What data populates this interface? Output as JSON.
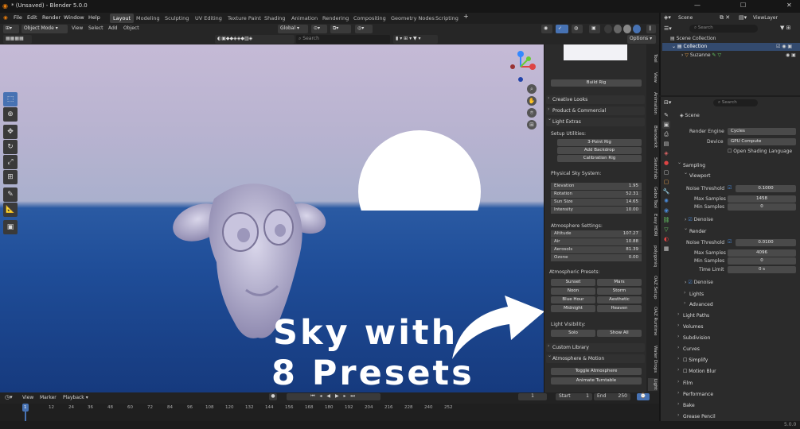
{
  "titlebar": {
    "title": "* (Unsaved) - Blender 5.0.0"
  },
  "menus": [
    "File",
    "Edit",
    "Render",
    "Window",
    "Help"
  ],
  "workspaces": [
    "Layout",
    "Modeling",
    "Sculpting",
    "UV Editing",
    "Texture Paint",
    "Shading",
    "Animation",
    "Rendering",
    "Compositing",
    "Geometry Nodes",
    "Scripting"
  ],
  "topright": {
    "scene": "Scene",
    "viewlayer": "ViewLayer"
  },
  "header": {
    "mode": "Object Mode",
    "menus": [
      "View",
      "Select",
      "Add",
      "Object"
    ],
    "orientation": "Global",
    "options": "Options",
    "search_placeholder": "Search"
  },
  "overlay": {
    "line1": "Sky with",
    "line2": "8 Presets"
  },
  "npanel": {
    "build_rig": "Build Rig",
    "sections": {
      "creative": "Creative Looks",
      "product": "Product & Commercial",
      "light_extras": "Light Extras",
      "custom": "Custom Library",
      "atmo_motion": "Atmosphere & Motion"
    },
    "setup_label": "Setup Utilities:",
    "setup_buttons": [
      "3-Point Rig",
      "Add Backdrop",
      "Calibration Rig"
    ],
    "sky_label": "Physical Sky System:",
    "sky_fields": [
      {
        "label": "Elevation",
        "value": "1.95"
      },
      {
        "label": "Rotation",
        "value": "52.31"
      },
      {
        "label": "Sun Size",
        "value": "14.65"
      },
      {
        "label": "Intensity",
        "value": "10.00"
      }
    ],
    "atmo_label": "Atmosphere Settings:",
    "atmo_fields": [
      {
        "label": "Altitude",
        "value": "107.27"
      },
      {
        "label": "Air",
        "value": "10.88"
      },
      {
        "label": "Aerosols",
        "value": "81.39"
      },
      {
        "label": "Ozone",
        "value": "0.00"
      }
    ],
    "presets_label": "Atmospheric Presets:",
    "presets": [
      "Sunset",
      "Mars",
      "Noon",
      "Storm",
      "Blue Hour",
      "Aesthetic",
      "Midnight",
      "Heaven"
    ],
    "visibility_label": "Light Visibility:",
    "visibility_buttons": [
      "Solo",
      "Show All"
    ],
    "toggle_atmo": "Toggle Atmosphere",
    "animate_turntable": "Animate Turntable"
  },
  "vtabs": [
    "Tool",
    "View",
    "Animation",
    "Blenderkit",
    "Sketchfab",
    "Gobo Tool",
    "Easy HDRI",
    "polygoniq",
    "OAZ Setup",
    "OAZ Runtime",
    "Water Drops",
    "Light"
  ],
  "outliner": {
    "search_placeholder": "Search",
    "collection_root": "Scene Collection",
    "collection": "Collection",
    "object": "Suzanne"
  },
  "properties": {
    "search_placeholder": "Search",
    "scene": "Scene",
    "render_engine_label": "Render Engine",
    "render_engine": "Cycles",
    "device_label": "Device",
    "device": "GPU Compute",
    "osl_label": "Open Shading Language",
    "sampling": "Sampling",
    "viewport": "Viewport",
    "noise_threshold_label": "Noise Threshold",
    "viewport_noise": "0.1000",
    "max_samples_label": "Max Samples",
    "viewport_max": "1458",
    "min_samples_label": "Min Samples",
    "viewport_min": "0",
    "denoise": "Denoise",
    "render": "Render",
    "render_noise": "0.0100",
    "render_max": "4096",
    "render_min": "0",
    "time_limit_label": "Time Limit",
    "time_limit": "0 s",
    "lights": "Lights",
    "advanced": "Advanced",
    "collapsed": [
      "Light Paths",
      "Volumes",
      "Subdivision",
      "Curves",
      "Simplify",
      "Motion Blur",
      "Film",
      "Performance",
      "Bake",
      "Grease Pencil"
    ]
  },
  "timeline": {
    "menus": [
      "View",
      "Marker",
      "Playback"
    ],
    "current": "1",
    "start_label": "Start",
    "start": "1",
    "end_label": "End",
    "end": "250",
    "ticks": [
      "1",
      "12",
      "24",
      "36",
      "48",
      "60",
      "72",
      "84",
      "96",
      "108",
      "120",
      "132",
      "144",
      "156",
      "168",
      "180",
      "192",
      "204",
      "216",
      "228",
      "240",
      "252"
    ]
  },
  "status": {
    "version": "5.0.0"
  },
  "colors": {
    "accent": "#4772b3",
    "sun": "#ffffff",
    "sky_top": "#c5bad6",
    "ocean": "#1f4d98"
  }
}
